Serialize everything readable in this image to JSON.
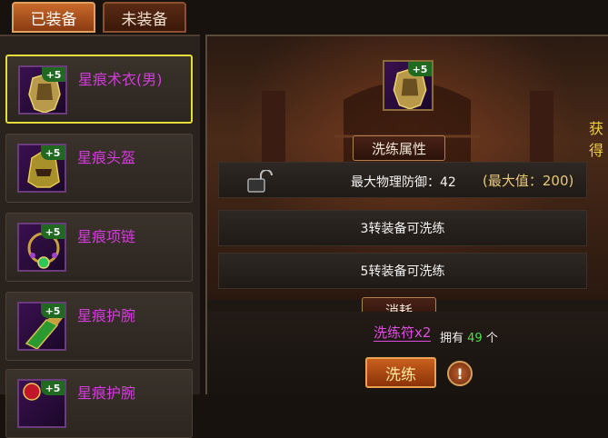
{
  "tabs": {
    "equipped": "已装备",
    "unequipped": "未装备"
  },
  "items": [
    {
      "name": "星痕术衣(男)",
      "level": "+5"
    },
    {
      "name": "星痕头盔",
      "level": "+5"
    },
    {
      "name": "星痕项链",
      "level": "+5"
    },
    {
      "name": "星痕护腕",
      "level": "+5"
    },
    {
      "name": "星痕护腕",
      "level": "+5"
    }
  ],
  "selected_item": {
    "level": "+5"
  },
  "side_text": "获得",
  "refine_section": {
    "title": "洗练属性",
    "stat_label": "最大物理防御：42",
    "max_value": "(最大值：200)",
    "requirement_3": "3转装备可洗练",
    "requirement_5": "5转装备可洗练"
  },
  "cost_section": {
    "title": "消耗",
    "cost_item": "洗练符x2",
    "owned_prefix": "拥有",
    "owned_count": "49",
    "owned_suffix": "个",
    "refine_button": "洗练",
    "info_button": "!"
  }
}
